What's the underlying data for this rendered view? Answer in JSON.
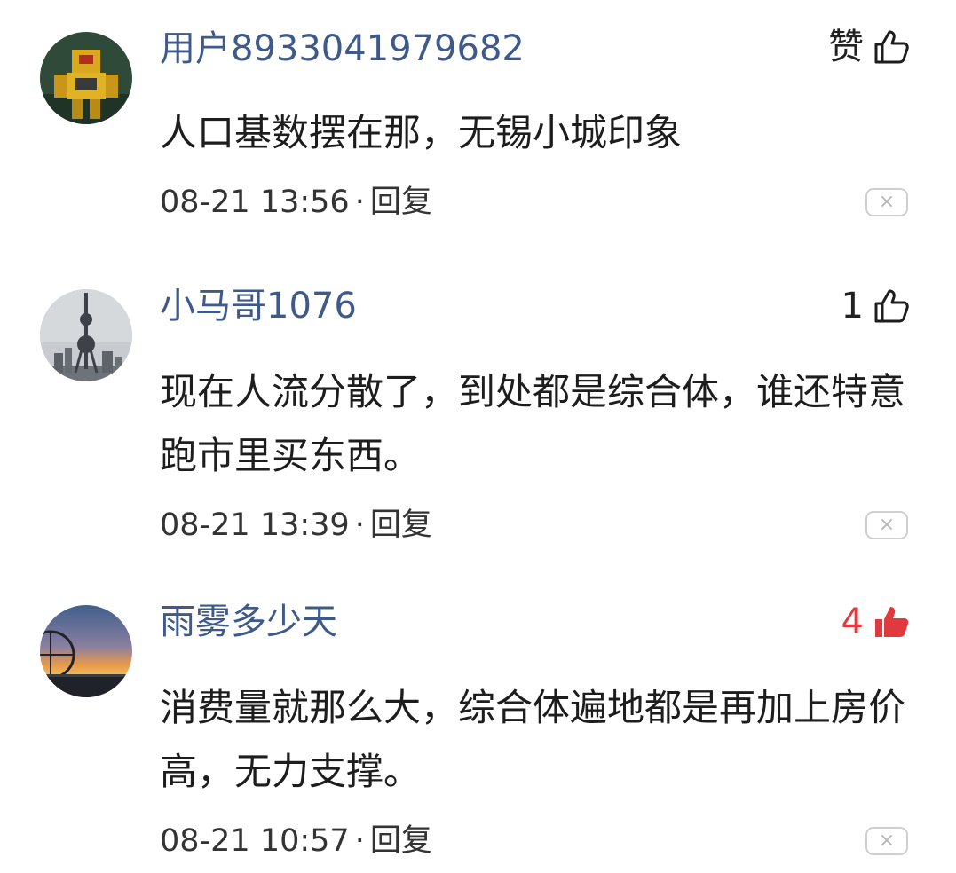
{
  "comments": [
    {
      "username": "用户8933041979682",
      "like_label": "赞",
      "liked": false,
      "content": "人口基数摆在那，无锡小城印象",
      "time": "08-21 13:56",
      "reply_label": "回复",
      "separator": "·",
      "close_glyph": "×"
    },
    {
      "username": "小马哥1076",
      "like_label": "1",
      "liked": false,
      "content": "现在人流分散了，到处都是综合体，谁还特意跑市里买东西。",
      "time": "08-21 13:39",
      "reply_label": "回复",
      "separator": "·",
      "close_glyph": "×"
    },
    {
      "username": "雨雾多少天",
      "like_label": "4",
      "liked": true,
      "content": "消费量就那么大，综合体遍地都是再加上房价高，无力支撑。",
      "time": "08-21 10:57",
      "reply_label": "回复",
      "separator": "·",
      "close_glyph": "×"
    }
  ],
  "colors": {
    "username": "#3d5a8a",
    "liked": "#e0393e",
    "text": "#1d1d1d"
  }
}
